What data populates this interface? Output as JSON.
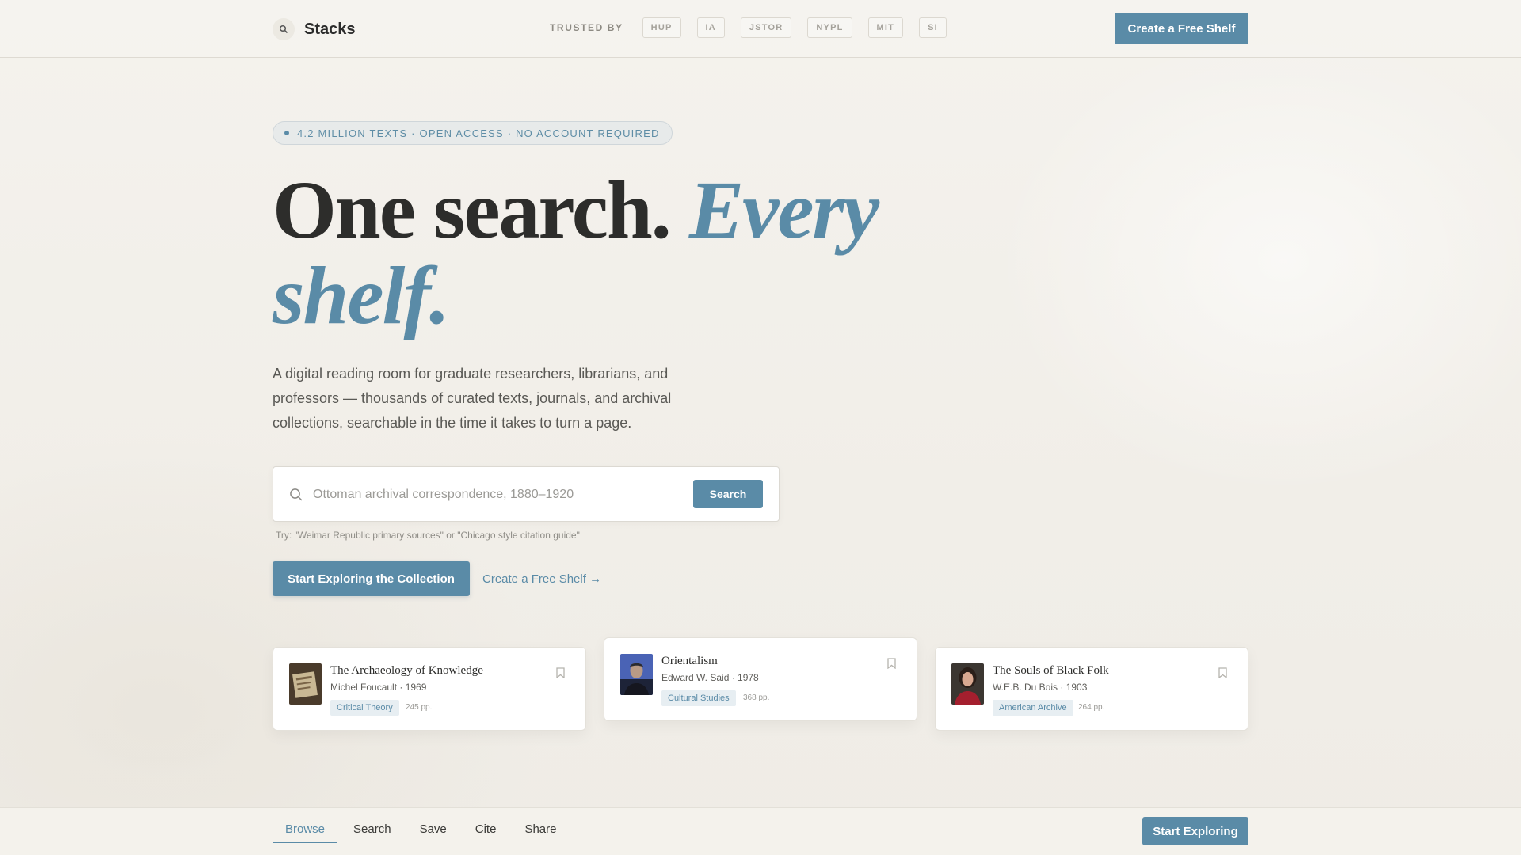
{
  "app": {
    "name": "Stacks"
  },
  "header": {
    "trusted_label": "TRUSTED BY",
    "partners": [
      "HUP",
      "IA",
      "JSTOR",
      "NYPL",
      "MIT",
      "SI"
    ],
    "cta_label": "Create a Free Shelf"
  },
  "hero": {
    "pill_text": "4.2 MILLION TEXTS · OPEN ACCESS · NO ACCOUNT REQUIRED",
    "headline_plain": "One search. ",
    "headline_accent": "Every shelf.",
    "lede": "A digital reading room for graduate researchers, librarians, and professors — thousands of curated texts, journals, and archival collections, searchable in the time it takes to turn a page.",
    "search": {
      "placeholder": "Ottoman archival correspondence, 1880–1920",
      "value": "",
      "button_label": "Search",
      "hint": "Try: \"Weimar Republic primary sources\" or \"Chicago style citation guide\""
    },
    "cta_primary": "Start Exploring the Collection",
    "cta_link": "Create a Free Shelf →"
  },
  "cards": [
    {
      "title": "The Archaeology of Knowledge",
      "meta": "Michel Foucault · 1969",
      "tag": "Critical Theory",
      "pages": "245 pp.",
      "thumb_color": "#6b5a44"
    },
    {
      "title": "Orientalism",
      "meta": "Edward W. Said · 1978",
      "tag": "Cultural Studies",
      "pages": "368 pp.",
      "thumb_color": "#3a4f8c"
    },
    {
      "title": "The Souls of Black Folk",
      "meta": "W.E.B. Du Bois · 1903",
      "tag": "American Archive",
      "pages": "264 pp.",
      "thumb_color": "#9a2330"
    }
  ],
  "bottom_bar": {
    "tabs": [
      "Browse",
      "Search",
      "Save",
      "Cite",
      "Share"
    ],
    "active_tab": "Browse",
    "cta_label": "Start Exploring"
  },
  "colors": {
    "accent": "#5a8ba7",
    "background": "#f3f1ec",
    "text": "#2d2d2b"
  }
}
